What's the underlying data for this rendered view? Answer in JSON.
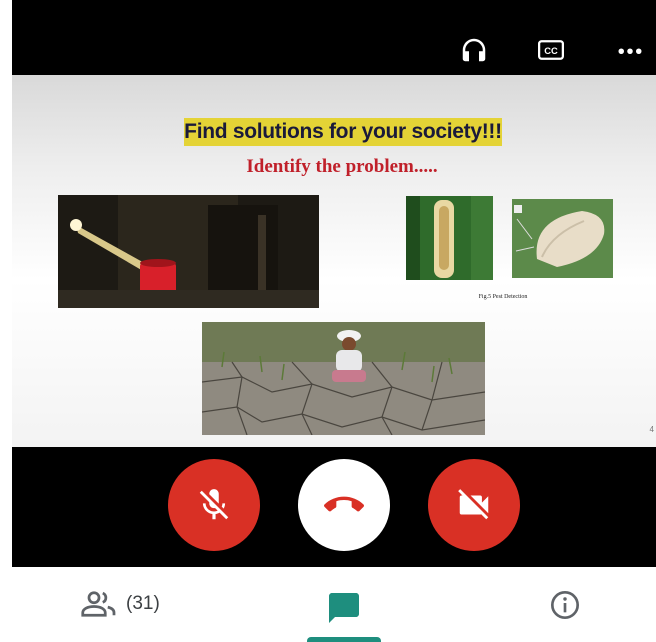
{
  "top_bar": {
    "icons": [
      "headphones-icon",
      "closed-captions-icon",
      "more-options-icon"
    ]
  },
  "slide": {
    "title": "Find solutions for your society!!!",
    "subtitle": "Identify the problem.....",
    "caption": "Fig.5 Pest Detection",
    "edge_mark": "4"
  },
  "call_controls": {
    "buttons": [
      "mic-off-button",
      "end-call-button",
      "camera-off-button"
    ]
  },
  "bottom_nav": {
    "participants_count": "(31)"
  },
  "colors": {
    "accent_red": "#d93025",
    "accent_teal": "#1e8e7e",
    "title_highlight": "#e4d336",
    "subtitle_red": "#c0202a"
  }
}
